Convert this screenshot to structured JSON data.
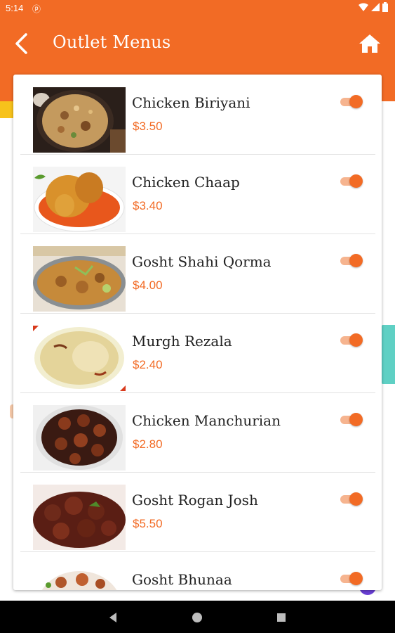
{
  "status_bar": {
    "time": "5:14",
    "notification": "ⓟ"
  },
  "header": {
    "title": "Outlet Menus"
  },
  "menu_items": [
    {
      "name": "Chicken Biriyani",
      "price": "$3.50",
      "enabled": true
    },
    {
      "name": "Chicken Chaap",
      "price": "$3.40",
      "enabled": true
    },
    {
      "name": "Gosht Shahi Qorma",
      "price": "$4.00",
      "enabled": true
    },
    {
      "name": "Murgh Rezala",
      "price": "$2.40",
      "enabled": true
    },
    {
      "name": "Chicken Manchurian",
      "price": "$2.80",
      "enabled": true
    },
    {
      "name": "Gosht Rogan Josh",
      "price": "$5.50",
      "enabled": true
    },
    {
      "name": "Gosht Bhunaa",
      "price": "",
      "enabled": true
    }
  ],
  "colors": {
    "accent": "#f26b25",
    "price": "#f26b25"
  }
}
